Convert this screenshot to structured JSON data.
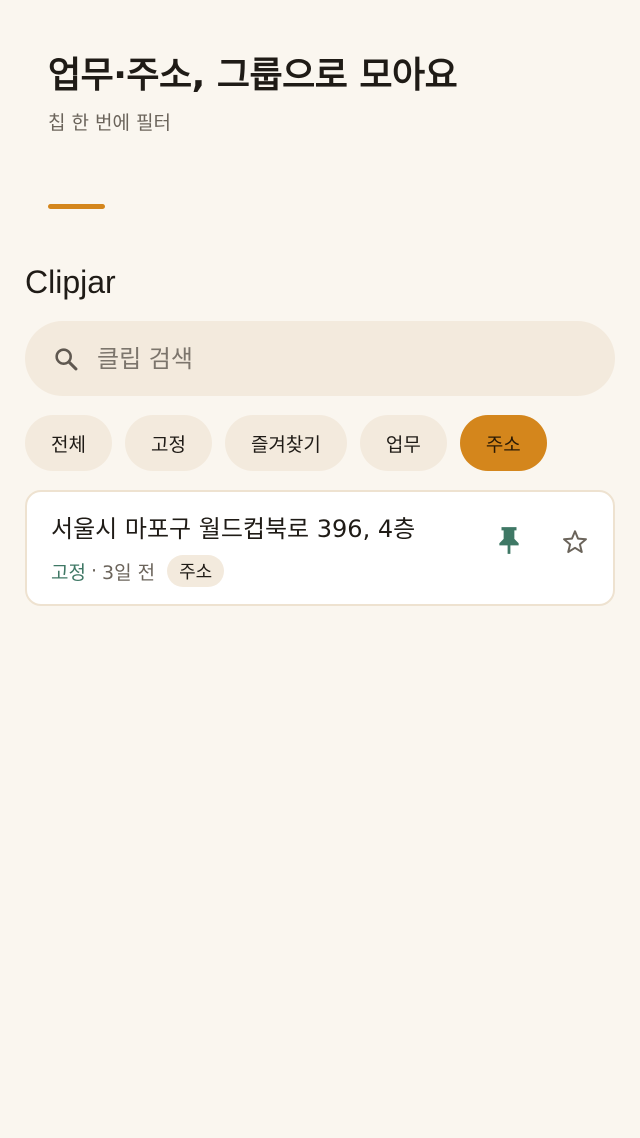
{
  "header": {
    "headline": "업무·주소, 그룹으로 모아요",
    "subhead": "칩 한 번에 필터"
  },
  "app": {
    "title": "Clipjar"
  },
  "search": {
    "placeholder": "클립 검색",
    "value": "",
    "icon": "search-icon"
  },
  "filters": {
    "chips": [
      "전체",
      "고정",
      "즐겨찾기",
      "업무",
      "주소"
    ],
    "selected": "주소"
  },
  "clips": [
    {
      "text": "서울시 마포구 월드컵북로 396, 4층",
      "status": "고정",
      "separator": "·",
      "time": "3일 전",
      "tag": "주소",
      "pinned": true,
      "starred": false
    }
  ],
  "colors": {
    "background": "#faf6ef",
    "accent": "#d4861c",
    "chip_bg": "#f3eadd",
    "pin": "#3f7865",
    "card_border": "#eee2d0"
  }
}
